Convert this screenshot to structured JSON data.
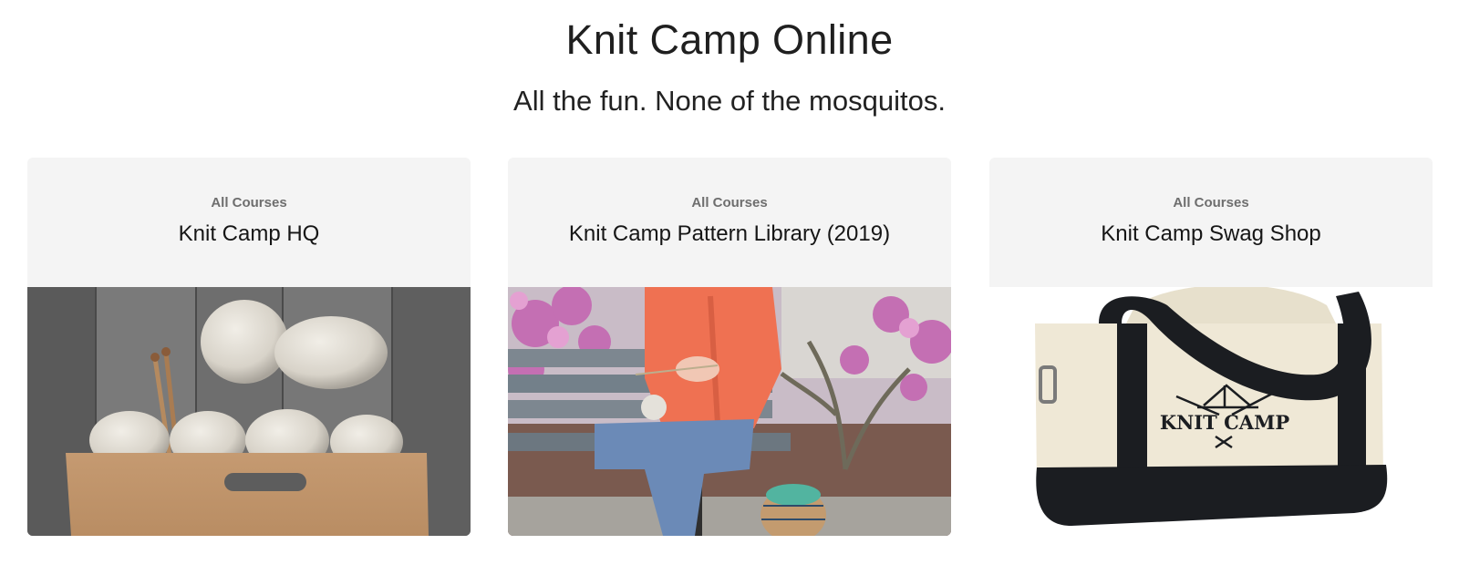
{
  "header": {
    "title": "Knit Camp Online",
    "subtitle": "All the fun. None of the mosquitos."
  },
  "courses": [
    {
      "category": "All Courses",
      "name": "Knit Camp HQ",
      "image_icon": "yarn-skeins-in-paper-bag-image"
    },
    {
      "category": "All Courses",
      "name": "Knit Camp Pattern Library (2019)",
      "image_icon": "person-knitting-on-bench-image"
    },
    {
      "category": "All Courses",
      "name": "Knit Camp Swag Shop",
      "image_icon": "knit-camp-tote-bag-image",
      "tote_logo_text": "KNIT CAMP"
    }
  ],
  "colors": {
    "card_header_bg": "#f4f4f4",
    "category_text": "#6e6e6e",
    "title_text": "#1f1f1f"
  }
}
